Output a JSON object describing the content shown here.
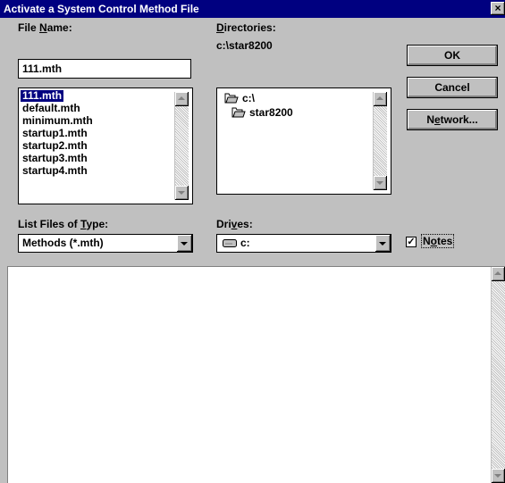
{
  "window": {
    "title": "Activate a System Control Method File",
    "close_label": "×"
  },
  "file_name": {
    "label_pre": "File ",
    "label_accel": "N",
    "label_post": "ame:",
    "value": "111.mth"
  },
  "file_list": {
    "items": [
      "111.mth",
      "default.mth",
      "minimum.mth",
      "startup1.mth",
      "startup2.mth",
      "startup3.mth",
      "startup4.mth"
    ],
    "selected_index": 0
  },
  "directories": {
    "label_accel": "D",
    "label_post": "irectories:",
    "current_path": "c:\\star8200",
    "tree": [
      {
        "label": "c:\\",
        "icon": "open-folder-icon"
      },
      {
        "label": "star8200",
        "icon": "open-folder-icon"
      }
    ]
  },
  "buttons": {
    "ok": "OK",
    "cancel": "Cancel",
    "network_accel": "e",
    "network_pre": "N",
    "network_post": "twork..."
  },
  "file_type": {
    "label_pre": "List Files of ",
    "label_accel": "T",
    "label_post": "ype:",
    "value": "Methods (*.mth)"
  },
  "drives": {
    "label_pre": "Dri",
    "label_accel": "v",
    "label_post": "es:",
    "value": "c:",
    "icon": "drive-icon"
  },
  "notes": {
    "checked": true,
    "check_mark": "✓",
    "label_pre": "N",
    "label_accel": "o",
    "label_post": "tes"
  },
  "colors": {
    "title_bar": "#000080",
    "dialog_bg": "#c0c0c0",
    "selection": "#000080"
  }
}
